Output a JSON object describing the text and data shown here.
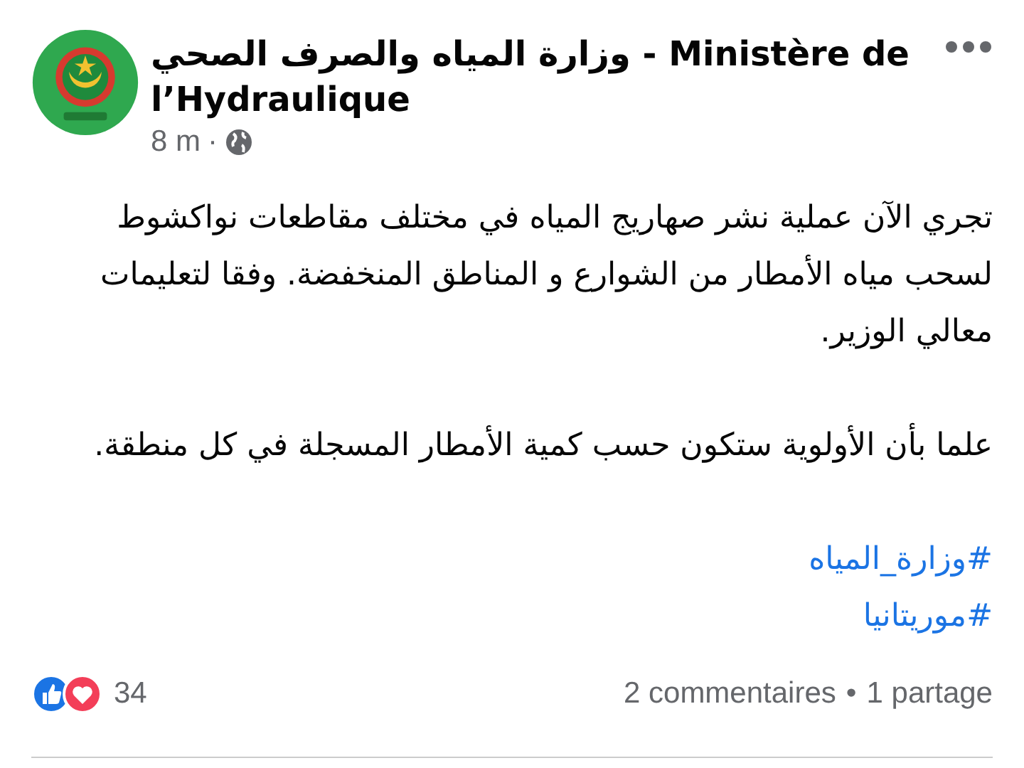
{
  "post": {
    "author": "وزارة المياه والصرف الصحي - Ministère de l’Hydraulique",
    "time": "8 m",
    "separator": "·",
    "paragraphs": [
      "تجري الآن عملية نشر صهاريج المياه في مختلف مقاطعات نواكشوط لسحب مياه الأمطار من الشوارع و المناطق المنخفضة. وفقا لتعليمات معالي الوزير.",
      "علما بأن الأولوية ستكون حسب كمية الأمطار المسجلة في كل منطقة."
    ],
    "hashtags": [
      "#وزارة_المياه",
      "#موريتانيا"
    ],
    "reaction_count": "34",
    "comments": "2 commentaires",
    "stats_separator": "•",
    "shares": "1 partage"
  }
}
